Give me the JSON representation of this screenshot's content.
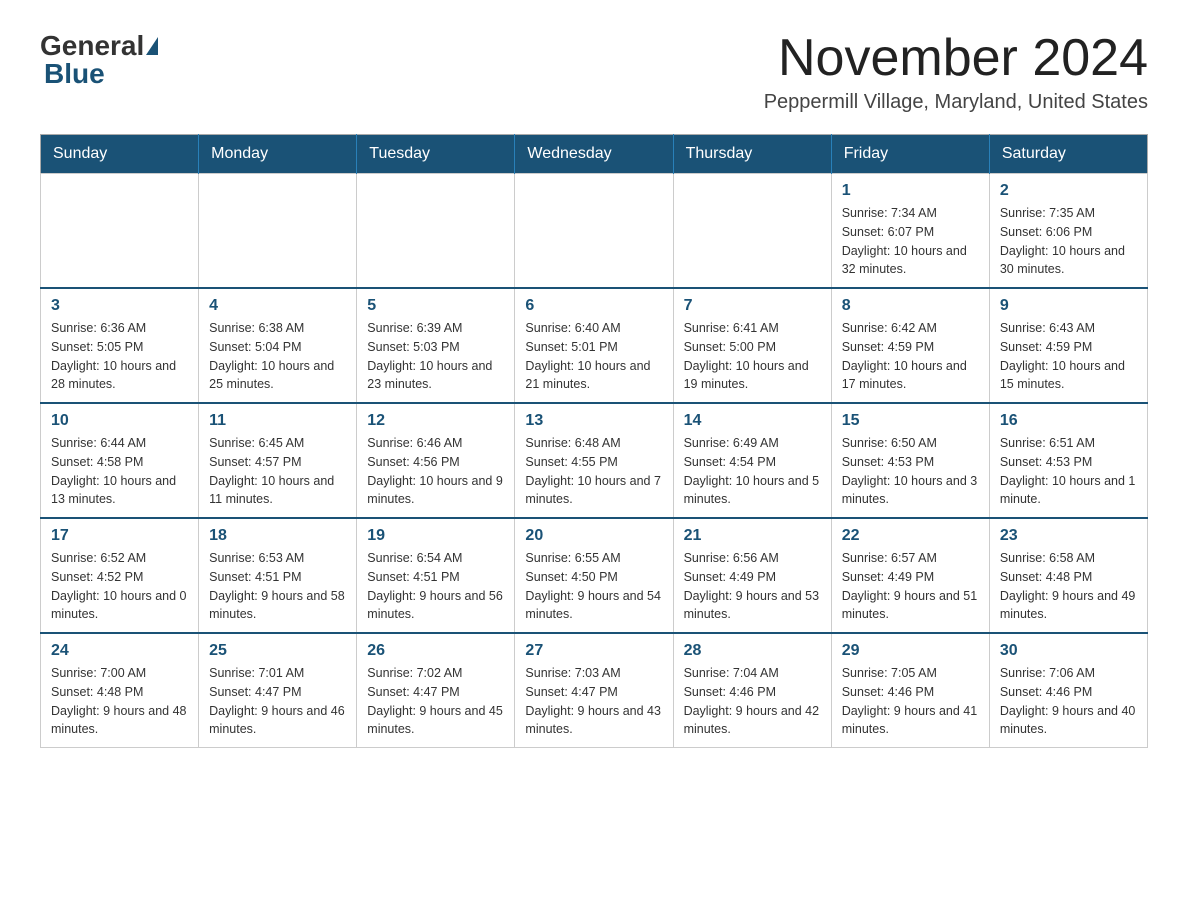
{
  "header": {
    "logo_general": "General",
    "logo_blue": "Blue",
    "month_title": "November 2024",
    "location": "Peppermill Village, Maryland, United States"
  },
  "days_of_week": [
    "Sunday",
    "Monday",
    "Tuesday",
    "Wednesday",
    "Thursday",
    "Friday",
    "Saturday"
  ],
  "weeks": [
    {
      "days": [
        {
          "number": "",
          "info": ""
        },
        {
          "number": "",
          "info": ""
        },
        {
          "number": "",
          "info": ""
        },
        {
          "number": "",
          "info": ""
        },
        {
          "number": "",
          "info": ""
        },
        {
          "number": "1",
          "info": "Sunrise: 7:34 AM\nSunset: 6:07 PM\nDaylight: 10 hours\nand 32 minutes."
        },
        {
          "number": "2",
          "info": "Sunrise: 7:35 AM\nSunset: 6:06 PM\nDaylight: 10 hours\nand 30 minutes."
        }
      ]
    },
    {
      "days": [
        {
          "number": "3",
          "info": "Sunrise: 6:36 AM\nSunset: 5:05 PM\nDaylight: 10 hours\nand 28 minutes."
        },
        {
          "number": "4",
          "info": "Sunrise: 6:38 AM\nSunset: 5:04 PM\nDaylight: 10 hours\nand 25 minutes."
        },
        {
          "number": "5",
          "info": "Sunrise: 6:39 AM\nSunset: 5:03 PM\nDaylight: 10 hours\nand 23 minutes."
        },
        {
          "number": "6",
          "info": "Sunrise: 6:40 AM\nSunset: 5:01 PM\nDaylight: 10 hours\nand 21 minutes."
        },
        {
          "number": "7",
          "info": "Sunrise: 6:41 AM\nSunset: 5:00 PM\nDaylight: 10 hours\nand 19 minutes."
        },
        {
          "number": "8",
          "info": "Sunrise: 6:42 AM\nSunset: 4:59 PM\nDaylight: 10 hours\nand 17 minutes."
        },
        {
          "number": "9",
          "info": "Sunrise: 6:43 AM\nSunset: 4:59 PM\nDaylight: 10 hours\nand 15 minutes."
        }
      ]
    },
    {
      "days": [
        {
          "number": "10",
          "info": "Sunrise: 6:44 AM\nSunset: 4:58 PM\nDaylight: 10 hours\nand 13 minutes."
        },
        {
          "number": "11",
          "info": "Sunrise: 6:45 AM\nSunset: 4:57 PM\nDaylight: 10 hours\nand 11 minutes."
        },
        {
          "number": "12",
          "info": "Sunrise: 6:46 AM\nSunset: 4:56 PM\nDaylight: 10 hours\nand 9 minutes."
        },
        {
          "number": "13",
          "info": "Sunrise: 6:48 AM\nSunset: 4:55 PM\nDaylight: 10 hours\nand 7 minutes."
        },
        {
          "number": "14",
          "info": "Sunrise: 6:49 AM\nSunset: 4:54 PM\nDaylight: 10 hours\nand 5 minutes."
        },
        {
          "number": "15",
          "info": "Sunrise: 6:50 AM\nSunset: 4:53 PM\nDaylight: 10 hours\nand 3 minutes."
        },
        {
          "number": "16",
          "info": "Sunrise: 6:51 AM\nSunset: 4:53 PM\nDaylight: 10 hours\nand 1 minute."
        }
      ]
    },
    {
      "days": [
        {
          "number": "17",
          "info": "Sunrise: 6:52 AM\nSunset: 4:52 PM\nDaylight: 10 hours\nand 0 minutes."
        },
        {
          "number": "18",
          "info": "Sunrise: 6:53 AM\nSunset: 4:51 PM\nDaylight: 9 hours\nand 58 minutes."
        },
        {
          "number": "19",
          "info": "Sunrise: 6:54 AM\nSunset: 4:51 PM\nDaylight: 9 hours\nand 56 minutes."
        },
        {
          "number": "20",
          "info": "Sunrise: 6:55 AM\nSunset: 4:50 PM\nDaylight: 9 hours\nand 54 minutes."
        },
        {
          "number": "21",
          "info": "Sunrise: 6:56 AM\nSunset: 4:49 PM\nDaylight: 9 hours\nand 53 minutes."
        },
        {
          "number": "22",
          "info": "Sunrise: 6:57 AM\nSunset: 4:49 PM\nDaylight: 9 hours\nand 51 minutes."
        },
        {
          "number": "23",
          "info": "Sunrise: 6:58 AM\nSunset: 4:48 PM\nDaylight: 9 hours\nand 49 minutes."
        }
      ]
    },
    {
      "days": [
        {
          "number": "24",
          "info": "Sunrise: 7:00 AM\nSunset: 4:48 PM\nDaylight: 9 hours\nand 48 minutes."
        },
        {
          "number": "25",
          "info": "Sunrise: 7:01 AM\nSunset: 4:47 PM\nDaylight: 9 hours\nand 46 minutes."
        },
        {
          "number": "26",
          "info": "Sunrise: 7:02 AM\nSunset: 4:47 PM\nDaylight: 9 hours\nand 45 minutes."
        },
        {
          "number": "27",
          "info": "Sunrise: 7:03 AM\nSunset: 4:47 PM\nDaylight: 9 hours\nand 43 minutes."
        },
        {
          "number": "28",
          "info": "Sunrise: 7:04 AM\nSunset: 4:46 PM\nDaylight: 9 hours\nand 42 minutes."
        },
        {
          "number": "29",
          "info": "Sunrise: 7:05 AM\nSunset: 4:46 PM\nDaylight: 9 hours\nand 41 minutes."
        },
        {
          "number": "30",
          "info": "Sunrise: 7:06 AM\nSunset: 4:46 PM\nDaylight: 9 hours\nand 40 minutes."
        }
      ]
    }
  ]
}
